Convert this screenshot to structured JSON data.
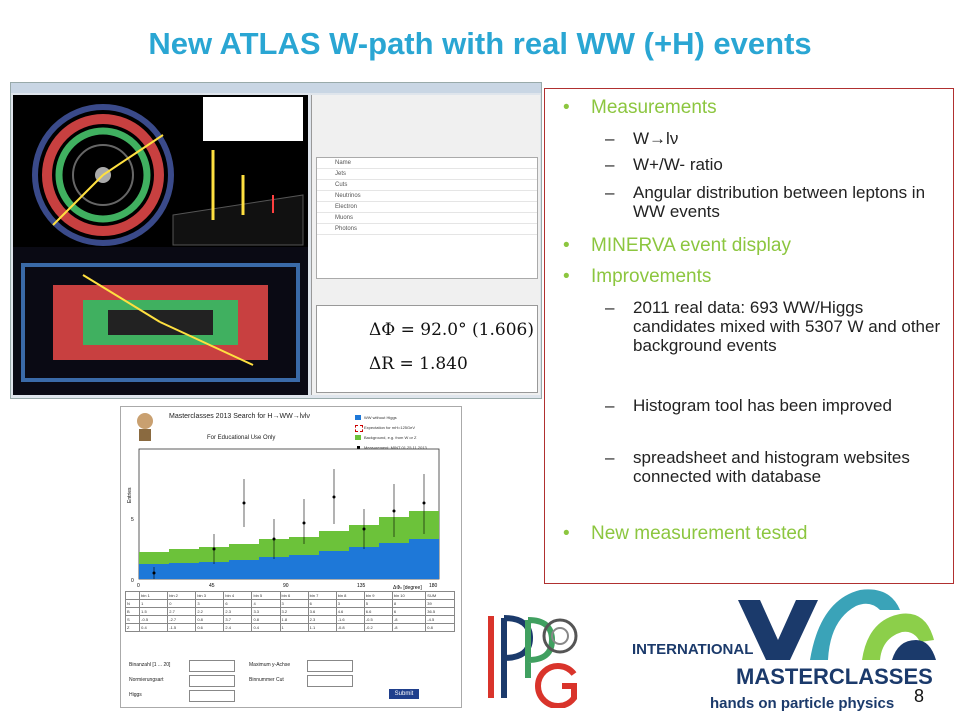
{
  "title": "New ATLAS W-path with real WW (+H) events",
  "bullets": {
    "b1": "Measurements",
    "b1_subs": [
      "W→lν",
      "W+/W- ratio",
      "Angular distribution between leptons in WW events"
    ],
    "b2": "MINERVA event display",
    "b3": "Improvements",
    "b3_subs": [
      "2011 real data: 693 WW/Higgs candidates mixed with 5307 W and other background events",
      "Histogram tool has been improved",
      "spreadsheet and histogram websites connected with database"
    ],
    "b4": "New measurement tested",
    "bullet_char": "•",
    "dash_char": "–"
  },
  "event_display": {
    "delta_phi": "ΔΦ = 92.0° (1.606)",
    "delta_r": "ΔR = 1.840",
    "cut_rows": [
      "Name",
      "Jets",
      "Cuts",
      "Neutrinos",
      "Electron",
      "Muons",
      "Photons"
    ]
  },
  "histogram": {
    "header": "Masterclasses 2013 Search for H→WW→lνlν",
    "edu_note": "For Educational Use Only",
    "y_label": "Entries",
    "x_label": "ΔΦₗₗ [degree]",
    "x_ticks": [
      "0",
      "45",
      "90",
      "135",
      "180"
    ],
    "legend": [
      "WW without Higgs",
      "Expectation for mH=125GeV",
      "Background, e.g. from W or Z",
      "Measurement: MINT 01.25.11.2013"
    ],
    "table_head": [
      "",
      "bin 1",
      "bin 2",
      "bin 3",
      "bin 4",
      "bin 5",
      "bin 6",
      "bin 7",
      "bin 8",
      "bin 9",
      "bin 10",
      "SUM"
    ],
    "table_rows": [
      [
        "N",
        "1",
        "0",
        "3",
        "6",
        "4",
        "3",
        "6",
        "3",
        "5",
        "8",
        "39"
      ],
      [
        "B",
        "1.5",
        "2.7",
        "2.2",
        "2.3",
        "3.3",
        "3.2",
        "3.6",
        "4.6",
        "6.6",
        "6",
        "36.5"
      ],
      [
        "S",
        "-0.5",
        "-2.7",
        "0.8",
        "3.7",
        "0.8",
        "1.8",
        "2.3",
        "-1.6",
        "-0.5",
        "-8",
        "-4.5"
      ],
      [
        "Z",
        "0.4",
        "-1.5",
        "0.6",
        "2.4",
        "0.4",
        "1",
        "1.1",
        "-0.8",
        "-0.2",
        "-8",
        "0.8"
      ]
    ],
    "form": {
      "binanzahl": "Binanzahl [1 ... 20]",
      "normierungsart": "Normierungsart",
      "higgs": "Higgs",
      "max_y": "Maximum y-Achse",
      "binnummer": "Binnummer Cut",
      "submit": "Submit"
    }
  },
  "logo": {
    "international": "INTERNATIONAL",
    "masterclasses": "MASTERCLASSES",
    "tagline": "hands on particle physics"
  },
  "page_number": "8",
  "colors": {
    "title": "#2aa6d3",
    "bullet": "#8cc63f",
    "box_border": "#b03030",
    "logo_navy": "#1b3a6b",
    "logo_teal": "#3aa3b8"
  }
}
